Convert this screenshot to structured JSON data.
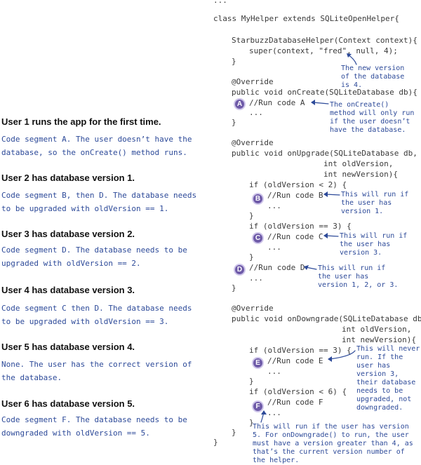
{
  "left": {
    "users": [
      {
        "heading": "User 1 runs the app for the first time.",
        "desc": "Code segment A. The user doesn’t have the database, so the onCreate() method runs."
      },
      {
        "heading": "User 2 has database version 1.",
        "desc": "Code segment B, then D. The database needs to be upgraded with oldVersion == 1."
      },
      {
        "heading": "User 3 has database version 2.",
        "desc": "Code segment D. The database needs to be upgraded with oldVersion == 2."
      },
      {
        "heading": "User 4 has database version 3.",
        "desc": "Code segment C then D. The database needs to be upgraded with oldVersion == 3."
      },
      {
        "heading": "User 5 has database version 4.",
        "desc": "None. The user has the correct version of the database."
      },
      {
        "heading": "User 6 has database version 5.",
        "desc": "Code segment F. The database needs to be downgraded with oldVersion == 5."
      }
    ]
  },
  "code": {
    "top_dots": "...",
    "class_decl": "class MyHelper extends SQLiteOpenHelper{",
    "ctor": "StarbuzzDatabaseHelper(Context context){",
    "super_call": "super(context, \"fred\", null, 4);",
    "close1": "}",
    "override1": "@Override",
    "oncreate_sig": "public void onCreate(SQLiteDatabase db){",
    "run_a": "//Run code A",
    "dots_a": "...",
    "close2": "}",
    "override2": "@Override",
    "onupgrade_sig": "public void onUpgrade(SQLiteDatabase db,",
    "up_param2": "int oldVersion,",
    "up_param3": "int newVersion){",
    "if_lt2": "if (oldVersion < 2) {",
    "run_b": "//Run code B",
    "dots_b": "...",
    "close_b": "}",
    "if_eq3": "if (oldVersion == 3) {",
    "run_c": "//Run code C",
    "dots_c": "...",
    "close_c": "}",
    "run_d": "//Run code D",
    "dots_d": "...",
    "close3": "}",
    "override3": "@Override",
    "ondowngrade_sig": "public void onDowngrade(SQLiteDatabase db,",
    "down_param2": "int oldVersion,",
    "down_param3": "int newVersion){",
    "if_eq3b": "if (oldVersion == 3) {",
    "run_e": "//Run code E",
    "dots_e": "...",
    "close_e": "}",
    "if_lt6": "if (oldVersion < 6) {",
    "run_f": "//Run code F",
    "dots_f": "...",
    "close_f": "}",
    "close4": "}",
    "close_class": "}"
  },
  "badges": {
    "a": "A",
    "b": "B",
    "c": "C",
    "d": "D",
    "e": "E",
    "f": "F"
  },
  "notes": {
    "version": "The new version of the database is 4.",
    "oncreate": "The onCreate() method will only run if the user doesn’t have the database.",
    "b": "This will run if the user has version 1.",
    "c": "This will run if the user has version 3.",
    "d": "This will run if the user has version 1, 2, or 3.",
    "e": "This will never run. If the user has version 3, their database needs to be upgraded, not downgraded.",
    "f": "This will run if the user has version 5. For onDowngrade() to run, the user must have a version greater than 4, as that’s the current version number of the helper."
  },
  "colors": {
    "annotation": "#2d4a99",
    "badge": "#6e5aa8",
    "code": "#3a3a3a"
  }
}
